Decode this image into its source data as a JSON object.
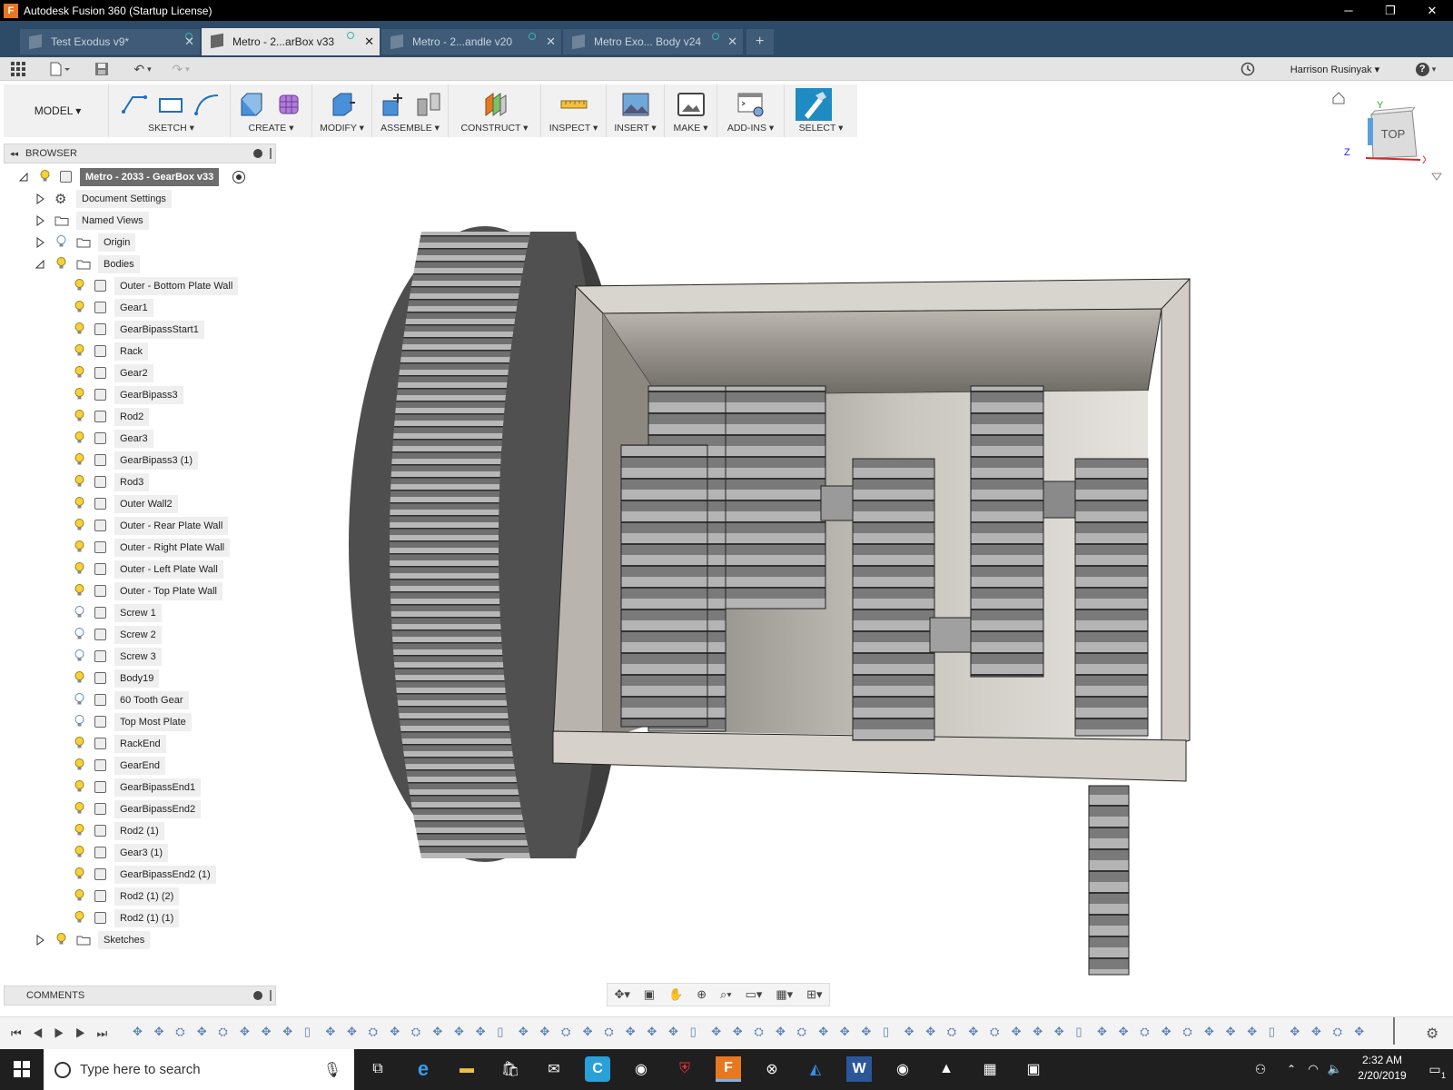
{
  "window": {
    "title": "Autodesk Fusion 360 (Startup License)",
    "minimize": "─",
    "maximize": "❐",
    "close": "✕"
  },
  "doc_tabs": [
    {
      "label": "Test Exodus v9*"
    },
    {
      "label": "Metro - 2...arBox v33"
    },
    {
      "label": "Metro - 2...andle v20"
    },
    {
      "label": "Metro Exo... Body v24"
    }
  ],
  "doc_tab_new": "+",
  "user": {
    "name": "Harrison Rusinyak ▾"
  },
  "help": "?",
  "ribbon": {
    "workspace": "MODEL ▾",
    "groups": [
      "SKETCH ▾",
      "CREATE ▾",
      "MODIFY ▾",
      "ASSEMBLE ▾",
      "CONSTRUCT ▾",
      "INSPECT ▾",
      "INSERT ▾",
      "MAKE ▾",
      "ADD-INS ▾",
      "SELECT ▾"
    ]
  },
  "browser": {
    "title": "BROWSER",
    "root": "Metro - 2033 - GearBox v33",
    "top_items": [
      "Document Settings",
      "Named Views",
      "Origin",
      "Bodies"
    ],
    "bodies": [
      "Outer - Bottom Plate Wall",
      "Gear1",
      "GearBipassStart1",
      "Rack",
      "Gear2",
      "GearBipass3",
      "Rod2",
      "Gear3",
      "GearBipass3 (1)",
      "Rod3",
      "Outer Wall2",
      "Outer - Rear Plate Wall",
      "Outer - Right Plate Wall",
      "Outer - Left Plate Wall",
      "Outer - Top Plate Wall",
      "Screw 1",
      "Screw 2",
      "Screw 3",
      "Body19",
      "60 Tooth Gear",
      "Top Most Plate",
      "RackEnd",
      "GearEnd",
      "GearBipassEnd1",
      "GearBipassEnd2",
      "Rod2 (1)",
      "Gear3 (1)",
      "GearBipassEnd2 (1)",
      "Rod2 (1) (2)",
      "Rod2 (1) (1)"
    ],
    "sketches": "Sketches"
  },
  "comments": {
    "title": "COMMENTS"
  },
  "viewcube": {
    "face": "TOP",
    "axis_x": "X",
    "axis_y": "Y",
    "axis_z": "Z"
  },
  "taskbar": {
    "search_placeholder": "Type here to search",
    "time": "2:32 AM",
    "date": "2/20/2019",
    "notif_count": "1"
  }
}
